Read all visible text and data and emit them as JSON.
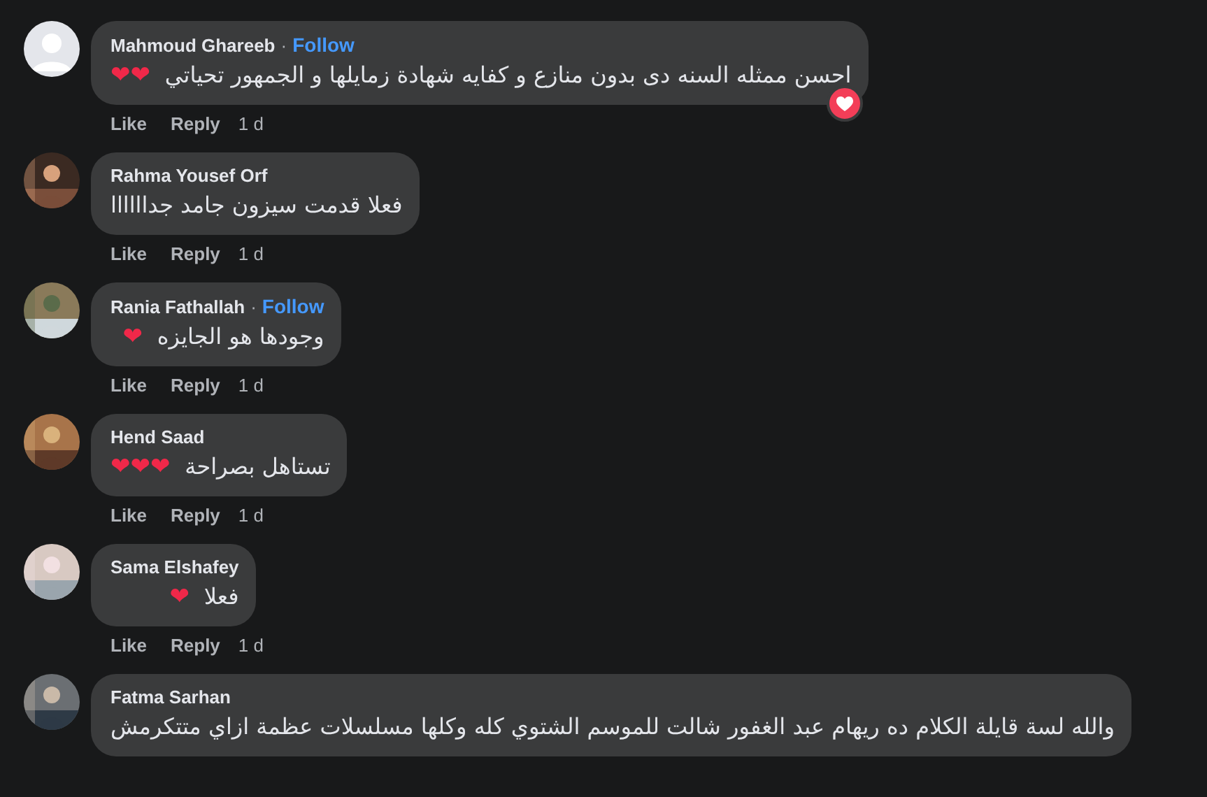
{
  "comments": [
    {
      "author": "Mahmoud Ghareeb",
      "avatar": {
        "kind": "default"
      },
      "separator": "·",
      "follow": "Follow",
      "text": "احسن ممثله السنه دى بدون منازع و كفايه شهادة زمايلها و الجمهور تحياتي",
      "emoji": "❤❤",
      "reaction": {
        "kind": "heart"
      },
      "actions": [
        "Like",
        "Reply"
      ],
      "time": "1 d"
    },
    {
      "author": "Rahma Yousef Orf",
      "text": "فعلا قدمت سيزون جامد جداااااا",
      "actions": [
        "Like",
        "Reply"
      ],
      "time": "1 d"
    },
    {
      "author": "Rania Fathallah",
      "separator": "·",
      "follow": "Follow",
      "text": "وجودها هو الجايزه",
      "emoji": "❤",
      "actions": [
        "Like",
        "Reply"
      ],
      "time": "1 d"
    },
    {
      "author": "Hend Saad",
      "text": "تستاهل بصراحة",
      "emoji": "❤❤❤",
      "actions": [
        "Like",
        "Reply"
      ],
      "time": "1 d"
    },
    {
      "author": "Sama Elshafey",
      "text": "فعلا",
      "emoji": "❤",
      "actions": [
        "Like",
        "Reply"
      ],
      "time": "1 d"
    },
    {
      "author": "Fatma Sarhan",
      "text": "والله لسة قايلة الكلام ده ريهام عبد الغفور شالت للموسم الشتوي كله وكلها مسلسلات عظمة ازاي متتكرمش"
    }
  ]
}
